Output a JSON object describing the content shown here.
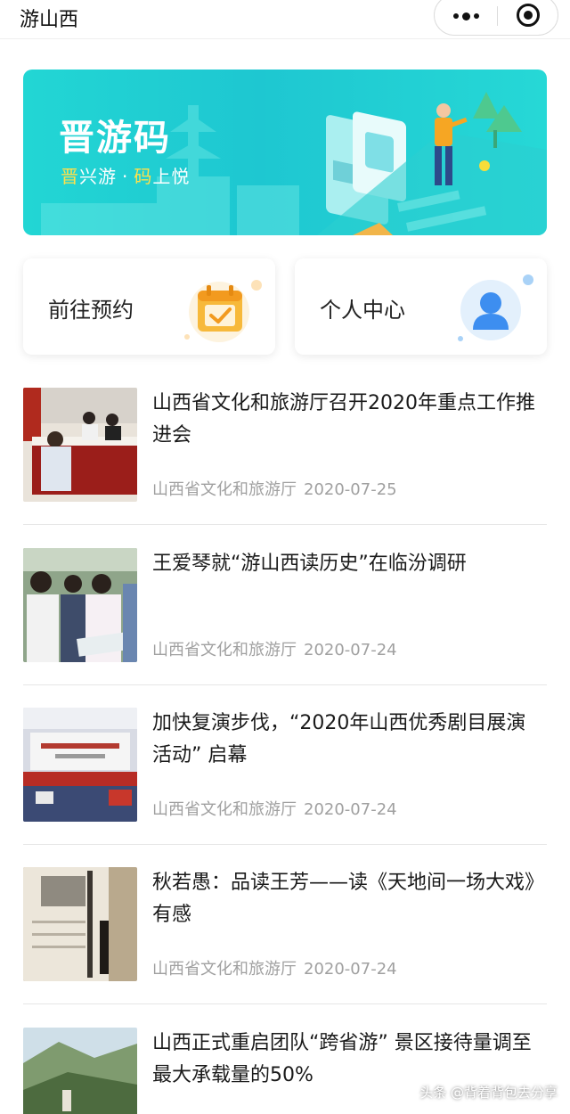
{
  "header": {
    "title": "游山西"
  },
  "banner": {
    "title": "晋游码",
    "subtitle_parts": [
      "晋",
      "兴游",
      "·",
      "码",
      "上悦"
    ]
  },
  "quick_actions": [
    {
      "label": "前往预约",
      "icon": "calendar-check-icon"
    },
    {
      "label": "个人中心",
      "icon": "user-avatar-icon"
    }
  ],
  "news": [
    {
      "title": "山西省文化和旅游厅召开2020年重点工作推进会",
      "source": "山西省文化和旅游厅",
      "date": "2020-07-25"
    },
    {
      "title": "王爱琴就“游山西读历史”在临汾调研",
      "source": "山西省文化和旅游厅",
      "date": "2020-07-24"
    },
    {
      "title": "加快复演步伐，“2020年山西优秀剧目展演活动” 启幕",
      "source": "山西省文化和旅游厅",
      "date": "2020-07-24"
    },
    {
      "title": "秋若愚：品读王芳——读《天地间一场大戏》有感",
      "source": "山西省文化和旅游厅",
      "date": "2020-07-24"
    },
    {
      "title": "山西正式重启团队“跨省游” 景区接待量调至最大承载量的50%",
      "source": "",
      "date": ""
    }
  ],
  "watermark": "头条 @背着背包去分享",
  "colors": {
    "banner": "#22d6d4",
    "highlight": "#ffe14a",
    "meta": "#a0a0a0"
  }
}
